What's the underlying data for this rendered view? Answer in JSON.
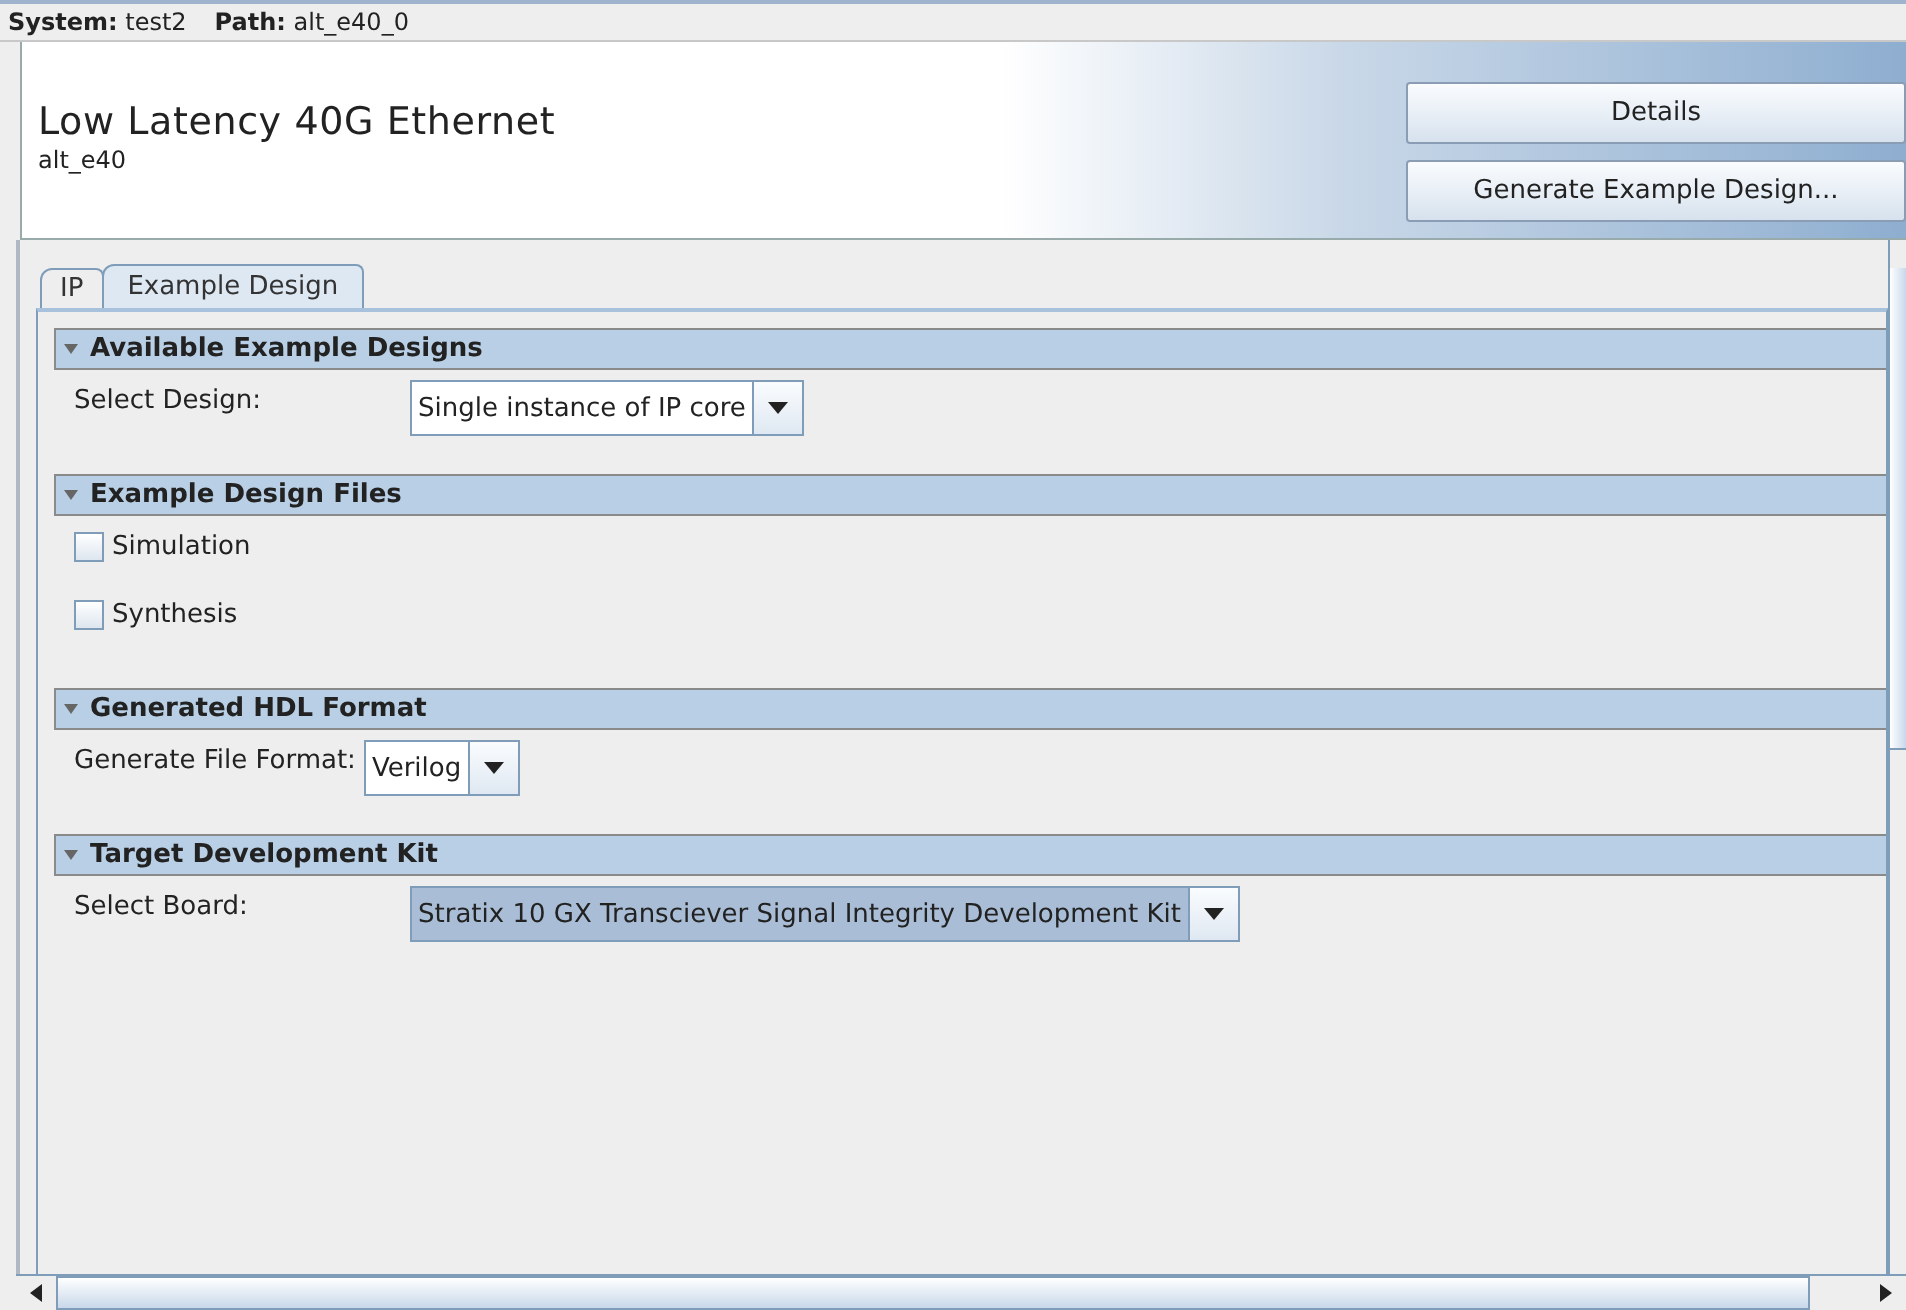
{
  "context_bar": {
    "system": "**System:** test2",
    "path": "**Path:** alt_e40_0"
  },
  "header": {
    "title": "Low Latency 40G Ethernet",
    "subtitle": "alt_e40"
  },
  "buttons": [
    {
      "label": "Details"
    },
    {
      "label": "Generate Example Design..."
    }
  ],
  "tabs": [
    {
      "label": "IP",
      "selected": false
    },
    {
      "label": "Example Design",
      "selected": true
    }
  ],
  "sections": [
    {
      "title": "Available Example Designs",
      "expanded": true,
      "fields": [
        {
          "kind": "dropdown",
          "label": "Select Design:",
          "value": "Single instance of IP core",
          "focused": false
        }
      ]
    },
    {
      "title": "Example Design Files",
      "expanded": true,
      "fields": [
        {
          "kind": "checkbox",
          "label": "Simulation",
          "checked": false
        },
        {
          "kind": "checkbox",
          "label": "Synthesis",
          "checked": false
        }
      ]
    },
    {
      "title": "Generated HDL Format",
      "expanded": true,
      "fields": [
        {
          "kind": "dropdown",
          "label": "Generate File Format:",
          "value": "Verilog",
          "focused": false
        }
      ]
    },
    {
      "title": "Target Development Kit",
      "expanded": true,
      "fields": [
        {
          "kind": "dropdown",
          "label": "Select Board:",
          "value": "Stratix 10 GX Transciever Signal Integrity Development Kit",
          "focused": true
        }
      ]
    }
  ]
}
